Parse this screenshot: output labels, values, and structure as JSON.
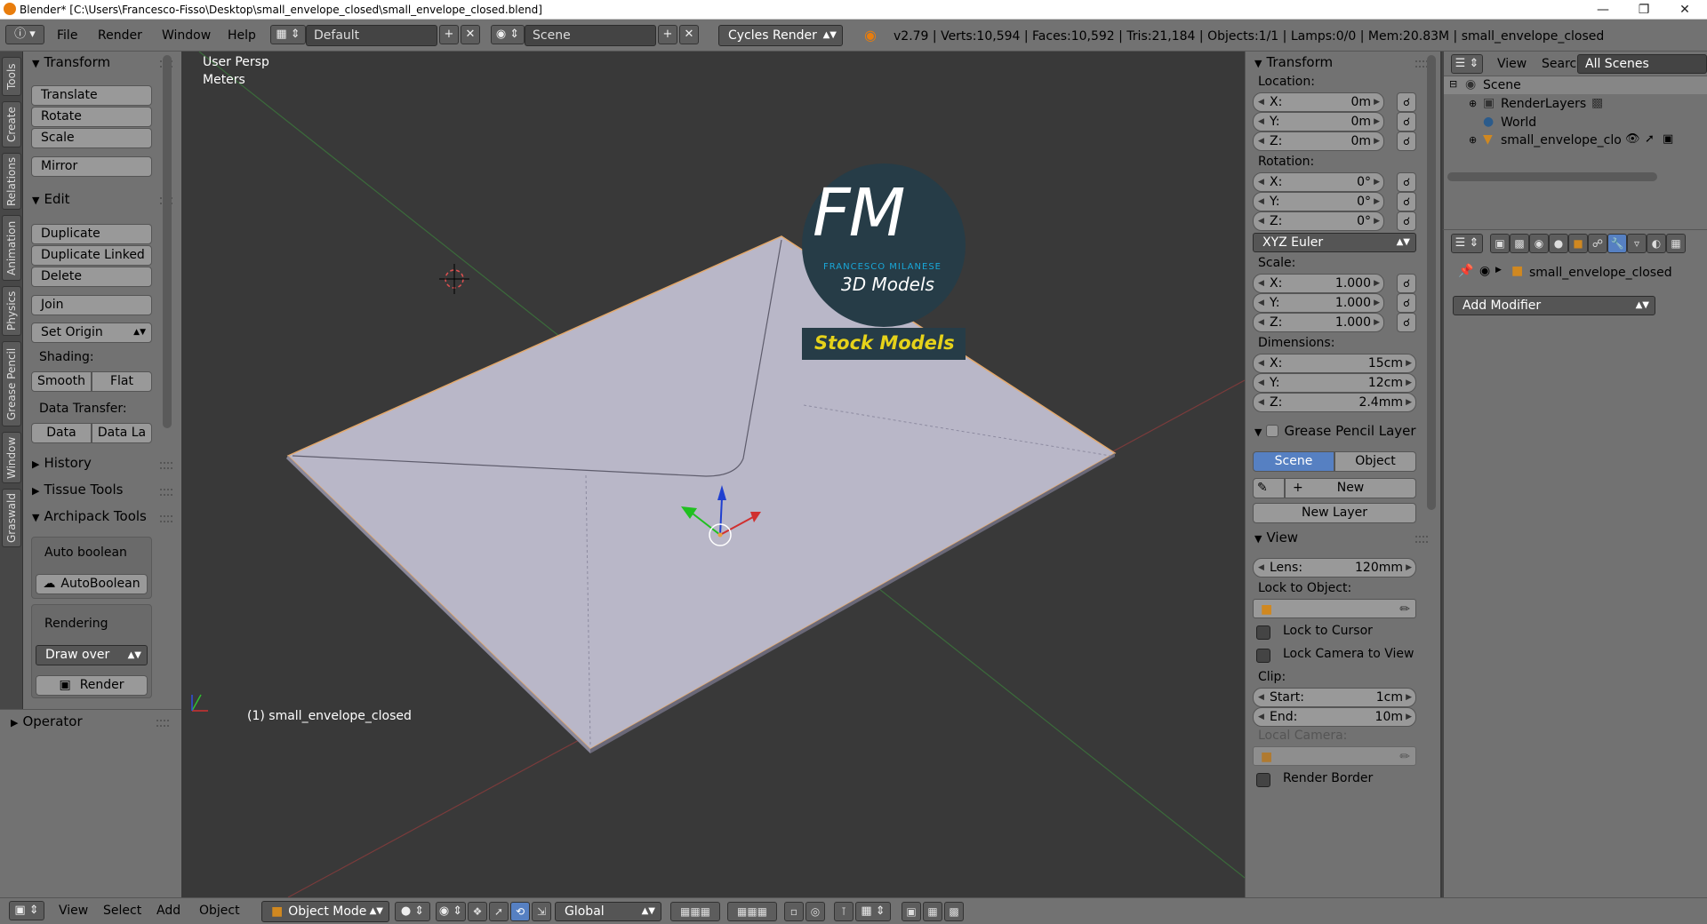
{
  "titlebar": {
    "title": "Blender* [C:\\Users\\Francesco-Fisso\\Desktop\\small_envelope_closed\\small_envelope_closed.blend]"
  },
  "menu": {
    "file": "File",
    "render": "Render",
    "window": "Window",
    "help": "Help"
  },
  "header": {
    "layout": "Default",
    "scene": "Scene",
    "engine": "Cycles Render",
    "stats": "v2.79 | Verts:10,594 | Faces:10,592 | Tris:21,184 | Objects:1/1 | Lamps:0/0 | Mem:20.83M | small_envelope_closed"
  },
  "left_tabs": [
    "Tools",
    "Create",
    "Relations",
    "Animation",
    "Physics",
    "Grease Pencil",
    "Window",
    "Graswald"
  ],
  "toolshelf": {
    "transform": {
      "title": "Transform",
      "translate": "Translate",
      "rotate": "Rotate",
      "scale": "Scale",
      "mirror": "Mirror"
    },
    "edit": {
      "title": "Edit",
      "duplicate": "Duplicate",
      "duplicate_linked": "Duplicate Linked",
      "delete": "Delete",
      "join": "Join",
      "set_origin": "Set Origin"
    },
    "shading": {
      "label": "Shading:",
      "smooth": "Smooth",
      "flat": "Flat"
    },
    "data_transfer": {
      "label": "Data Transfer:",
      "data": "Data",
      "data_la": "Data La"
    },
    "history": "History",
    "tissue": "Tissue Tools",
    "archipack": {
      "title": "Archipack Tools",
      "auto_boolean": "Auto boolean",
      "autoboolean_btn": "AutoBoolean",
      "rendering": "Rendering",
      "draw_over": "Draw over",
      "render": "Render"
    },
    "operator": "Operator"
  },
  "viewport": {
    "view_name": "User Persp",
    "units": "Meters",
    "object_label": "(1) small_envelope_closed",
    "logo": {
      "letters": "FM",
      "name": "FRANCESCO MILANESE",
      "sub": "3D Models",
      "banner": "Stock Models"
    }
  },
  "npanel": {
    "transform_title": "Transform",
    "location_label": "Location:",
    "location": [
      {
        "k": "X:",
        "v": "0m"
      },
      {
        "k": "Y:",
        "v": "0m"
      },
      {
        "k": "Z:",
        "v": "0m"
      }
    ],
    "rotation_label": "Rotation:",
    "rotation": [
      {
        "k": "X:",
        "v": "0°"
      },
      {
        "k": "Y:",
        "v": "0°"
      },
      {
        "k": "Z:",
        "v": "0°"
      }
    ],
    "rotation_mode": "XYZ Euler",
    "scale_label": "Scale:",
    "scale": [
      {
        "k": "X:",
        "v": "1.000"
      },
      {
        "k": "Y:",
        "v": "1.000"
      },
      {
        "k": "Z:",
        "v": "1.000"
      }
    ],
    "dimensions_label": "Dimensions:",
    "dimensions": [
      {
        "k": "X:",
        "v": "15cm"
      },
      {
        "k": "Y:",
        "v": "12cm"
      },
      {
        "k": "Z:",
        "v": "2.4mm"
      }
    ],
    "grease_title": "Grease Pencil Layer",
    "grease_scene": "Scene",
    "grease_object": "Object",
    "grease_new": "New",
    "grease_new_layer": "New Layer",
    "view_title": "View",
    "lens_k": "Lens:",
    "lens_v": "120mm",
    "lock_to_object": "Lock to Object:",
    "lock_to_cursor": "Lock to Cursor",
    "lock_camera": "Lock Camera to View",
    "clip_label": "Clip:",
    "clip_start_k": "Start:",
    "clip_start_v": "1cm",
    "clip_end_k": "End:",
    "clip_end_v": "10m",
    "local_camera": "Local Camera:",
    "render_border": "Render Border"
  },
  "outliner": {
    "view": "View",
    "search": "Search",
    "filter": "All Scenes",
    "items": {
      "scene": "Scene",
      "renderlayers": "RenderLayers",
      "world": "World",
      "object": "small_envelope_closed"
    }
  },
  "properties": {
    "object_name": "small_envelope_closed",
    "add_modifier": "Add Modifier"
  },
  "bottombar": {
    "view": "View",
    "select": "Select",
    "add": "Add",
    "object": "Object",
    "mode": "Object Mode",
    "orientation": "Global"
  }
}
